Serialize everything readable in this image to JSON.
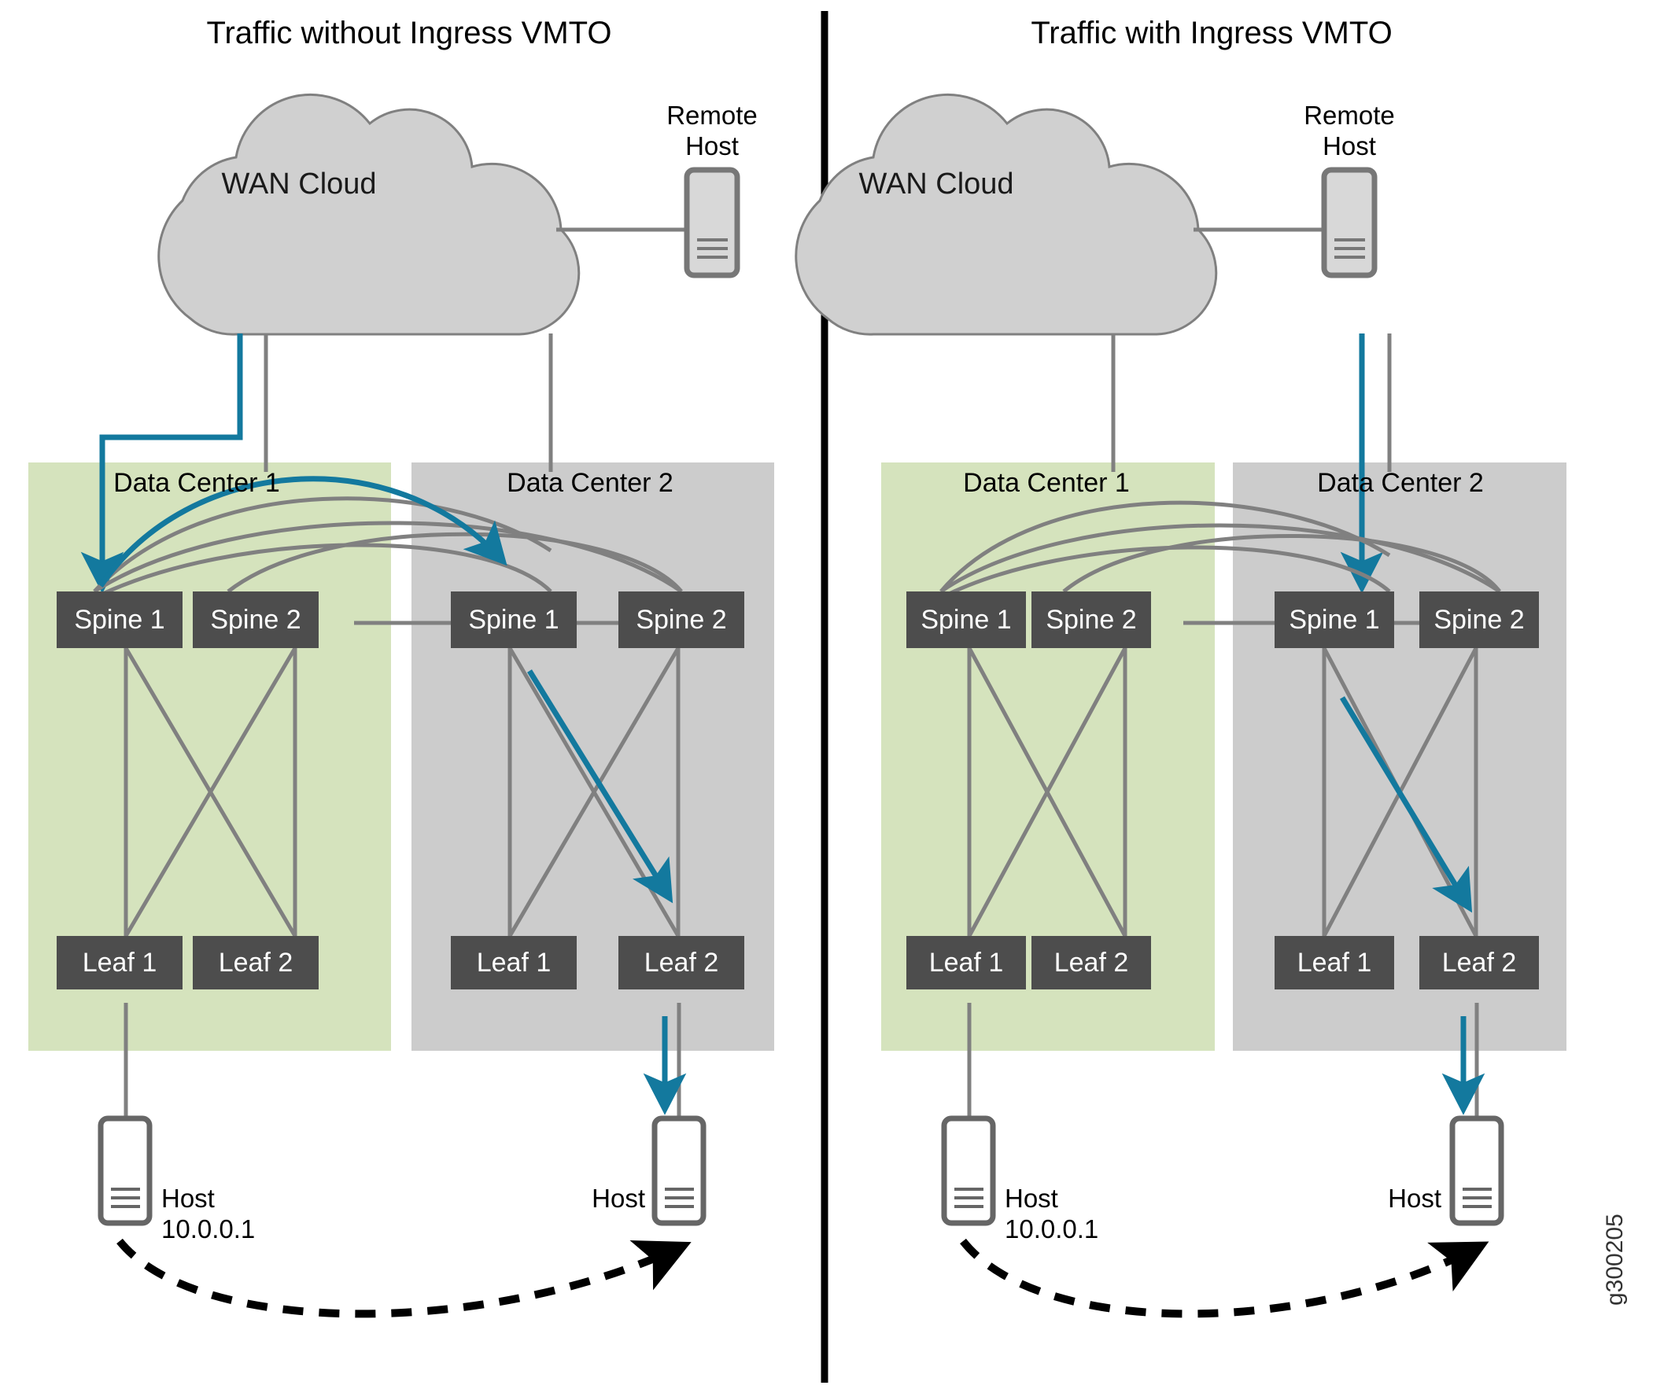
{
  "figure": {
    "id_label": "g300205",
    "divider_color": "#000000",
    "colors": {
      "dc1_fill": "#d5e3bd",
      "dc2_fill": "#cccccc",
      "node_fill": "#4d4d4d",
      "node_text": "#ffffff",
      "cloud_fill": "#d0d0d0",
      "cloud_stroke": "#808080",
      "link_gray": "#808080",
      "accent_teal": "#13799e",
      "host_stroke": "#666666",
      "dashed_black": "#000000"
    }
  },
  "panels": [
    {
      "key": "without_vmto",
      "title": "Traffic without Ingress VMTO",
      "wan": {
        "label": "WAN Cloud"
      },
      "remote_host": {
        "label_line1": "Remote",
        "label_line2": "Host"
      },
      "data_centers": [
        {
          "key": "dc1",
          "label": "Data Center 1",
          "fill": "#d5e3bd",
          "spines": [
            "Spine 1",
            "Spine 2"
          ],
          "leaves": [
            "Leaf 1",
            "Leaf 2"
          ],
          "host": {
            "label_line1": "Host",
            "label_line2": "10.0.0.1"
          }
        },
        {
          "key": "dc2",
          "label": "Data Center 2",
          "fill": "#cccccc",
          "spines": [
            "Spine 1",
            "Spine 2"
          ],
          "leaves": [
            "Leaf 1",
            "Leaf 2"
          ],
          "host": {
            "label_line1": "Host",
            "label_line2": ""
          }
        }
      ],
      "traffic_path": [
        "WAN Cloud down to Data Center 1 Spine 1",
        "Data Center 1 Spine 1 arc to Data Center 2 Spine 1",
        "Data Center 2 Spine 1 down to Data Center 2 Leaf 2",
        "Data Center 2 Leaf 2 down to Host"
      ]
    },
    {
      "key": "with_vmto",
      "title": "Traffic with Ingress VMTO",
      "wan": {
        "label": "WAN Cloud"
      },
      "remote_host": {
        "label_line1": "Remote",
        "label_line2": "Host"
      },
      "data_centers": [
        {
          "key": "dc1",
          "label": "Data Center 1",
          "fill": "#d5e3bd",
          "spines": [
            "Spine 1",
            "Spine 2"
          ],
          "leaves": [
            "Leaf 1",
            "Leaf 2"
          ],
          "host": {
            "label_line1": "Host",
            "label_line2": "10.0.0.1"
          }
        },
        {
          "key": "dc2",
          "label": "Data Center 2",
          "fill": "#cccccc",
          "spines": [
            "Spine 1",
            "Spine 2"
          ],
          "leaves": [
            "Leaf 1",
            "Leaf 2"
          ],
          "host": {
            "label_line1": "Host",
            "label_line2": ""
          }
        }
      ],
      "traffic_path": [
        "WAN Cloud straight down to Data Center 2 Spine 1",
        "Data Center 2 Spine 1 down to Data Center 2 Leaf 2",
        "Data Center 2 Leaf 2 down to Host"
      ]
    }
  ]
}
